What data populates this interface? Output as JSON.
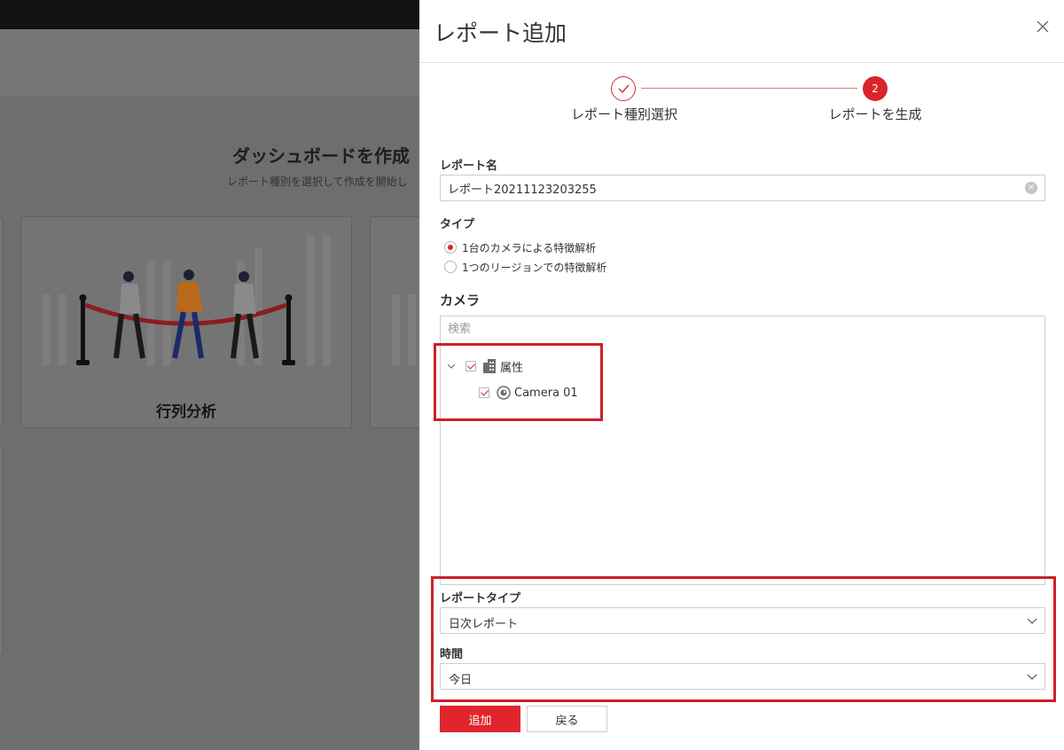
{
  "background": {
    "title": "ダッシュボードを作成",
    "subtitle": "レポート種別を選択して作成を開始し",
    "card_label": "行列分析"
  },
  "drawer": {
    "title": "レポート追加",
    "steps": [
      {
        "label": "レポート種別選択",
        "state": "done"
      },
      {
        "number": "2",
        "label": "レポートを生成",
        "state": "active"
      }
    ],
    "report_name": {
      "label": "レポート名",
      "value": "レポート20211123203255"
    },
    "type": {
      "label": "タイプ",
      "options": [
        {
          "label": "1台のカメラによる特徴解析",
          "checked": true
        },
        {
          "label": "1つのリージョンでの特徴解析",
          "checked": false
        }
      ]
    },
    "camera": {
      "title": "カメラ",
      "search_placeholder": "検索",
      "tree": {
        "root": {
          "label": "属性",
          "checked": true,
          "expanded": true
        },
        "children": [
          {
            "label": "Camera 01",
            "checked": true
          }
        ]
      }
    },
    "report_type": {
      "label": "レポートタイプ",
      "value": "日次レポート"
    },
    "time": {
      "label": "時間",
      "value": "今日"
    },
    "buttons": {
      "add": "追加",
      "back": "戻る"
    }
  },
  "colors": {
    "accent": "#e0262c",
    "highlight_box": "#cc2128"
  }
}
